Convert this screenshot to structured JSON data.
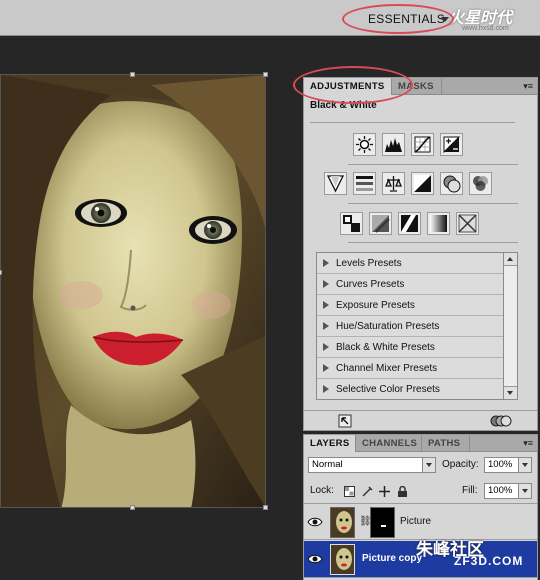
{
  "topbar": {
    "workspace_label": "ESSENTIALS",
    "watermark": "火星时代",
    "watermark_url": "www.hxsd.com"
  },
  "adjustments": {
    "tabs": [
      "ADJUSTMENTS",
      "MASKS"
    ],
    "title": "Black & White",
    "icon_rows": [
      [
        "brightness-contrast-icon",
        "levels-icon",
        "curves-icon",
        "exposure-icon"
      ],
      [
        "vibrance-icon",
        "hue-saturation-icon",
        "color-balance-icon",
        "black-white-icon",
        "photo-filter-icon",
        "channel-mixer-icon"
      ],
      [
        "invert-icon",
        "posterize-icon",
        "threshold-icon",
        "gradient-map-icon",
        "selective-color-icon"
      ]
    ],
    "presets": [
      "Levels Presets",
      "Curves Presets",
      "Exposure Presets",
      "Hue/Saturation Presets",
      "Black & White Presets",
      "Channel Mixer Presets",
      "Selective Color Presets"
    ]
  },
  "layers": {
    "tabs": [
      "LAYERS",
      "CHANNELS",
      "PATHS"
    ],
    "blend_mode": "Normal",
    "opacity_label": "Opacity:",
    "opacity_value": "100%",
    "lock_label": "Lock:",
    "fill_label": "Fill:",
    "fill_value": "100%",
    "items": [
      {
        "name": "Picture",
        "selected": false
      },
      {
        "name": "Picture copy",
        "selected": true
      }
    ]
  },
  "watermark_bottom": {
    "text": "朱峰社区",
    "url": "ZF3D.COM"
  },
  "colors": {
    "annotation": "#d94a55",
    "selection": "#1d3ba0",
    "panel_bg": "#d6d6d6",
    "workspace_bg": "#262626"
  }
}
